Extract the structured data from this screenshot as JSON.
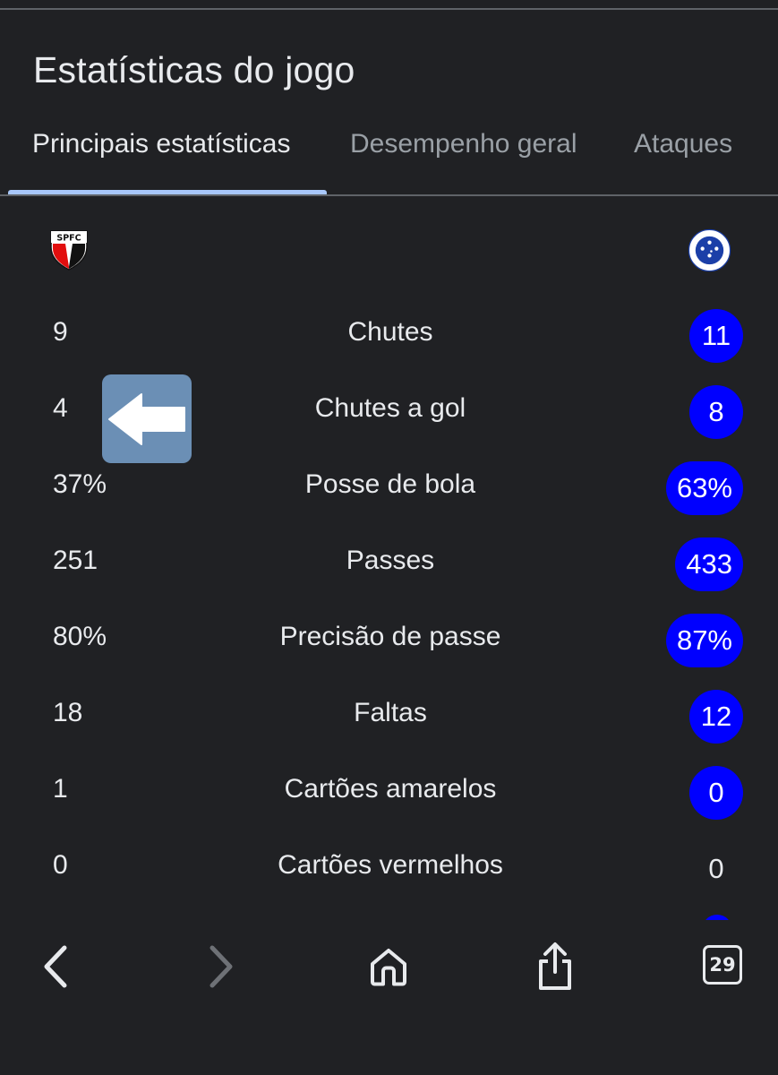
{
  "page": {
    "title": "Estatísticas do jogo"
  },
  "tabs": [
    {
      "label": "Principais estatísticas",
      "active": true
    },
    {
      "label": "Desempenho geral",
      "active": false
    },
    {
      "label": "Ataques",
      "active": false
    }
  ],
  "teams": {
    "home": {
      "logo_text": "SPFC",
      "logo_icon": "spfc-crest-icon"
    },
    "away": {
      "logo_icon": "cruzeiro-crest-icon"
    }
  },
  "stats": [
    {
      "label": "Chutes",
      "home": "9",
      "away": "11",
      "away_highlight": true
    },
    {
      "label": "Chutes a gol",
      "home": "4",
      "away": "8",
      "away_highlight": true
    },
    {
      "label": "Posse de bola",
      "home": "37%",
      "away": "63%",
      "away_highlight": true
    },
    {
      "label": "Passes",
      "home": "251",
      "away": "433",
      "away_highlight": true
    },
    {
      "label": "Precisão de passe",
      "home": "80%",
      "away": "87%",
      "away_highlight": true
    },
    {
      "label": "Faltas",
      "home": "18",
      "away": "12",
      "away_highlight": true
    },
    {
      "label": "Cartões amarelos",
      "home": "1",
      "away": "0",
      "away_highlight": true
    },
    {
      "label": "Cartões vermelhos",
      "home": "0",
      "away": "0",
      "away_highlight": false
    }
  ],
  "overlay": {
    "icon": "left-arrow-icon"
  },
  "browser_bar": {
    "back_icon": "back-chevron-icon",
    "forward_icon": "forward-chevron-icon",
    "home_icon": "home-icon",
    "share_icon": "share-icon",
    "tab_count": "29"
  },
  "colors": {
    "background": "#202124",
    "highlight": "#0000ff",
    "tab_indicator": "#a8c7fa",
    "overlay": "#6b8fb5"
  }
}
